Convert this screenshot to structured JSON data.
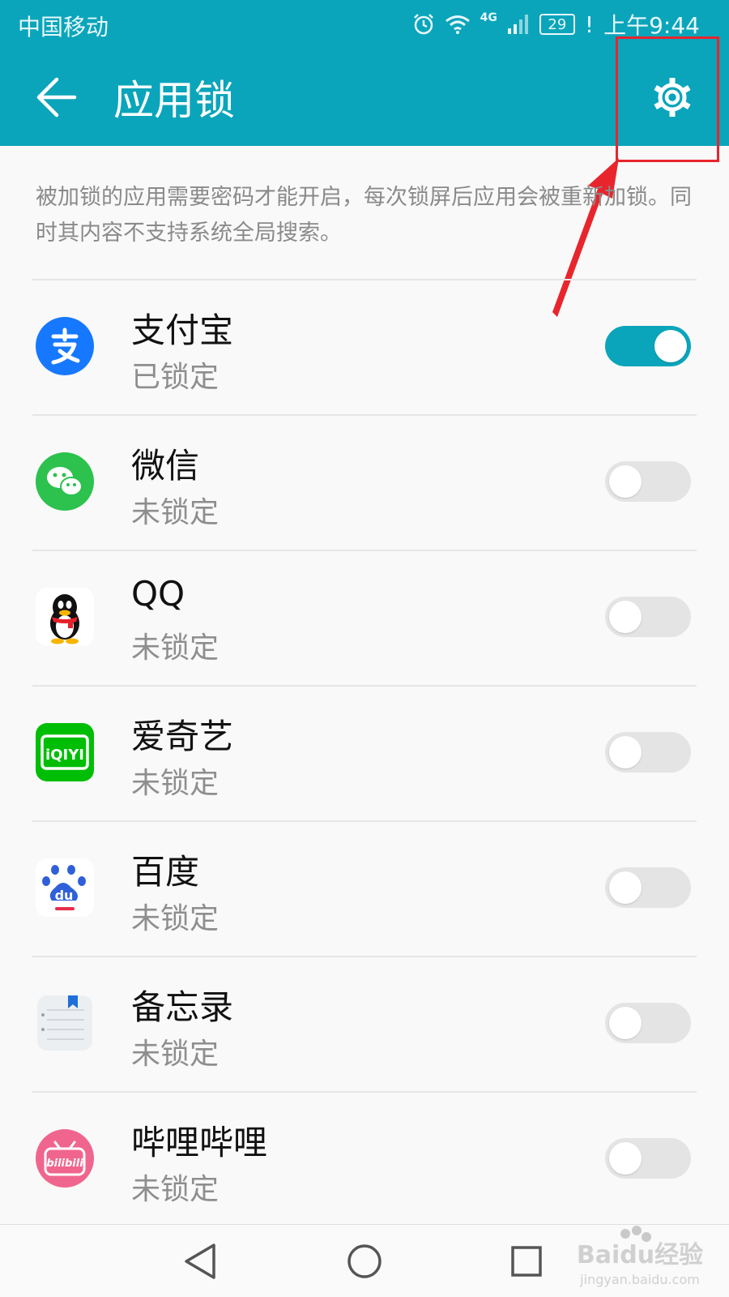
{
  "status_bar": {
    "carrier": "中国移动",
    "network": "4G",
    "battery": "29",
    "time": "上午9:44"
  },
  "app_bar": {
    "title": "应用锁"
  },
  "description": "被加锁的应用需要密码才能开启，每次锁屏后应用会被重新加锁。同时其内容不支持系统全局搜索。",
  "apps": [
    {
      "name": "支付宝",
      "status": "已锁定",
      "locked": true,
      "icon": "alipay-icon"
    },
    {
      "name": "微信",
      "status": "未锁定",
      "locked": false,
      "icon": "wechat-icon"
    },
    {
      "name": "QQ",
      "status": "未锁定",
      "locked": false,
      "icon": "qq-icon"
    },
    {
      "name": "爱奇艺",
      "status": "未锁定",
      "locked": false,
      "icon": "iqiyi-icon"
    },
    {
      "name": "百度",
      "status": "未锁定",
      "locked": false,
      "icon": "baidu-icon"
    },
    {
      "name": "备忘录",
      "status": "未锁定",
      "locked": false,
      "icon": "notes-icon"
    },
    {
      "name": "哔哩哔哩",
      "status": "未锁定",
      "locked": false,
      "icon": "bilibili-icon"
    }
  ],
  "icons": {
    "iqiyi_label": "iQIYI",
    "baidu_label": "du",
    "bilibili_label": "bilibili"
  },
  "watermark": {
    "brand": "Baidu经验",
    "url": "jingyan.baidu.com"
  },
  "colors": {
    "accent": "#0aa5bb",
    "annotation_red": "#e8252d"
  }
}
